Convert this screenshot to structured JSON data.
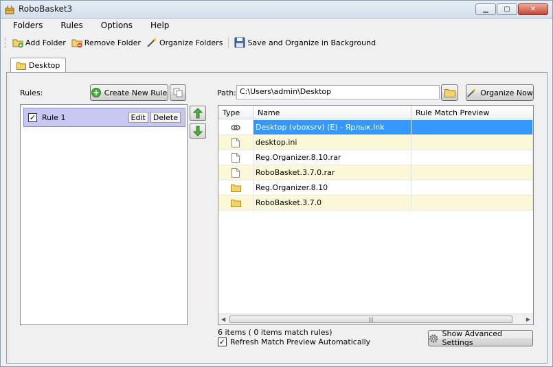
{
  "window": {
    "title": "RoboBasket3"
  },
  "menu": [
    "Folders",
    "Rules",
    "Options",
    "Help"
  ],
  "toolbar": {
    "add_folder": "Add Folder",
    "remove_folder": "Remove Folder",
    "organize_folders": "Organize Folders",
    "save_organize": "Save and Organize in Background"
  },
  "tab": {
    "label": "Desktop"
  },
  "rules": {
    "label": "Rules:",
    "create_label": "Create New Rule",
    "items": [
      {
        "label": "Rule 1",
        "checked": true,
        "edit": "Edit",
        "delete": "Delete"
      }
    ]
  },
  "path": {
    "label": "Path:",
    "value": "C:\\Users\\admin\\Desktop",
    "organize_now": "Organize Now"
  },
  "grid": {
    "headers": [
      "Type",
      "Name",
      "Rule Match Preview"
    ],
    "rows": [
      {
        "icon": "link-icon",
        "name": "Desktop (vboxsrv) (E) - Ярлык.lnk",
        "preview": "",
        "selected": true
      },
      {
        "icon": "file-icon",
        "name": "desktop.ini",
        "preview": ""
      },
      {
        "icon": "file-icon",
        "name": "Reg.Organizer.8.10.rar",
        "preview": ""
      },
      {
        "icon": "file-icon",
        "name": "RoboBasket.3.7.0.rar",
        "preview": ""
      },
      {
        "icon": "folder-icon",
        "name": "Reg.Organizer.8.10",
        "preview": ""
      },
      {
        "icon": "folder-icon",
        "name": "RoboBasket.3.7.0",
        "preview": ""
      }
    ]
  },
  "status": {
    "items_text": "6 items ( 0 items match rules)",
    "refresh_label": "Refresh Match Preview Automatically",
    "refresh_checked": true,
    "advanced_label": "Show Advanced Settings"
  },
  "colors": {
    "selected_row": "#3399ff",
    "alt_row": "#fbf8d8",
    "rule_selected": "#c6c8f2"
  }
}
